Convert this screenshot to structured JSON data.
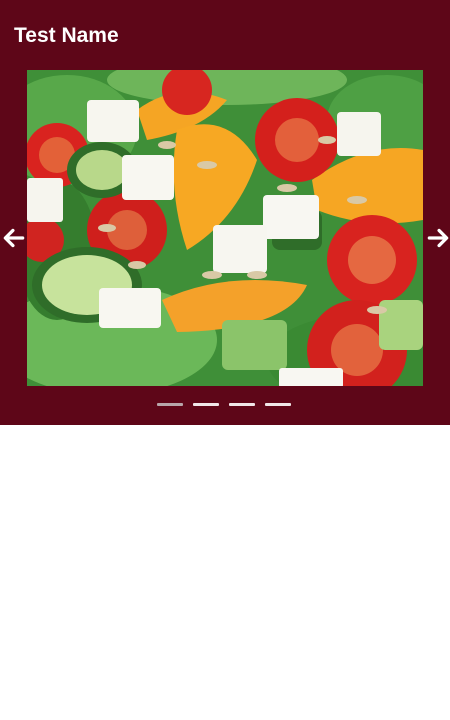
{
  "header": {
    "title": "Test Name",
    "background_color": "#5e0618"
  },
  "carousel": {
    "image_subject": "salad",
    "prev_icon": "arrow-left-icon",
    "next_icon": "arrow-right-icon",
    "indicator_count": 4,
    "active_index": 0
  }
}
